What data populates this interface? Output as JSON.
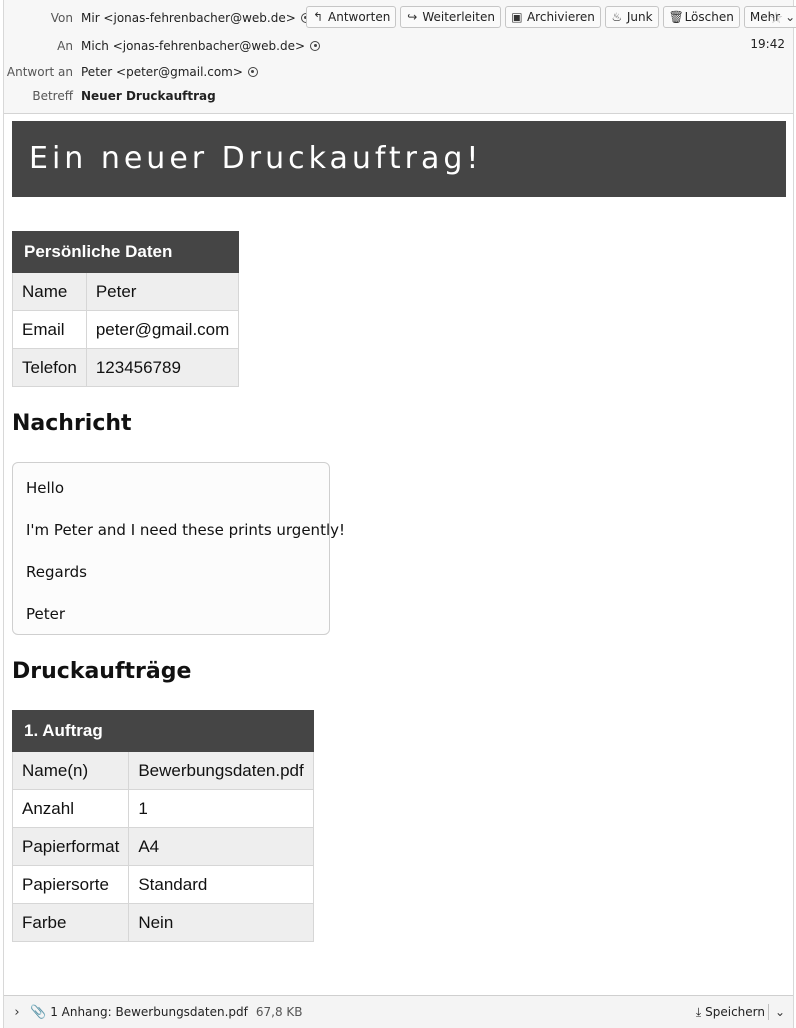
{
  "header": {
    "from_label": "Von",
    "from_value": "Mir <jonas-fehrenbacher@web.de>",
    "to_label": "An",
    "to_value": "Mich <jonas-fehrenbacher@web.de>",
    "reply_to_label": "Antwort an",
    "reply_to_value": "Peter <peter@gmail.com>",
    "subject_label": "Betreff",
    "subject_value": "Neuer Druckauftrag",
    "time": "19:42"
  },
  "toolbar": {
    "reply": "Antworten",
    "forward": "Weiterleiten",
    "archive": "Archivieren",
    "junk": "Junk",
    "delete": "Löschen",
    "more": "Mehr"
  },
  "body": {
    "banner": "Ein neuer Druckauftrag!",
    "personal": {
      "header": "Persönliche Daten",
      "rows": [
        {
          "label": "Name",
          "value": "Peter"
        },
        {
          "label": "Email",
          "value": "peter@gmail.com"
        },
        {
          "label": "Telefon",
          "value": "123456789"
        }
      ]
    },
    "message_heading": "Nachricht",
    "message_lines": [
      "Hello",
      "I'm Peter and I need these prints urgently!",
      "Regards",
      "Peter"
    ],
    "jobs_heading": "Druckaufträge",
    "job1": {
      "header": "1. Auftrag",
      "rows": [
        {
          "label": "Name(n)",
          "value": "Bewerbungsdaten.pdf"
        },
        {
          "label": "Anzahl",
          "value": "1"
        },
        {
          "label": "Papierformat",
          "value": "A4"
        },
        {
          "label": "Papiersorte",
          "value": "Standard"
        },
        {
          "label": "Farbe",
          "value": "Nein"
        }
      ]
    }
  },
  "footer": {
    "attachment_label": "1 Anhang: Bewerbungsdaten.pdf",
    "attachment_size": "67,8 KB",
    "save_label": "Speichern"
  }
}
